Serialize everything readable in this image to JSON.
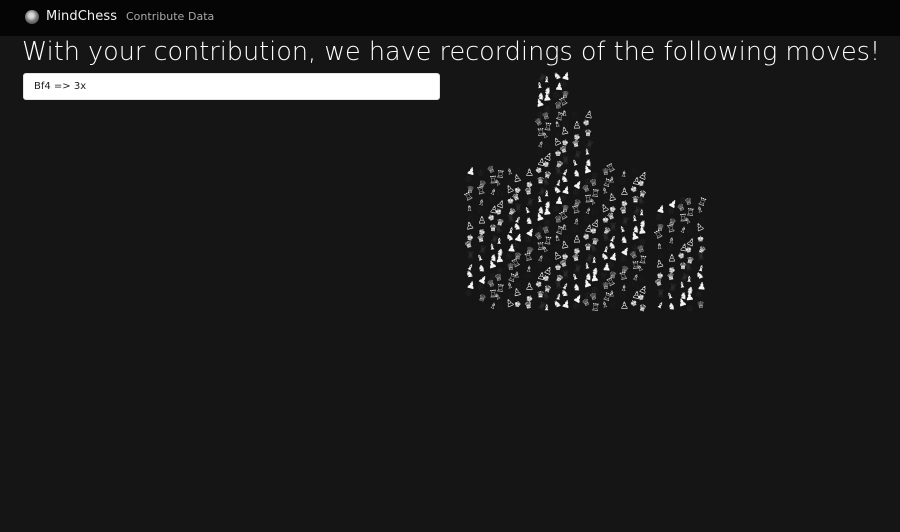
{
  "navbar": {
    "brand": "MindChess",
    "links": [
      "Contribute",
      "Data"
    ]
  },
  "main": {
    "title": "With your contribution, we have recordings of the following moves!",
    "moves_select": {
      "selected": "Bf4 => 3x"
    }
  },
  "colors": {
    "background": "#151515",
    "navbar": "#050505",
    "nav_link": "#a8a8a8",
    "title": "#ffffff"
  },
  "illustration": {
    "icon": "thumbs-up-chess-pieces-icon",
    "piece_glyphs": [
      "♔",
      "♕",
      "♖",
      "♗",
      "♘",
      "♙",
      "♚",
      "♛",
      "♜",
      "♝",
      "♞",
      "♟"
    ]
  }
}
